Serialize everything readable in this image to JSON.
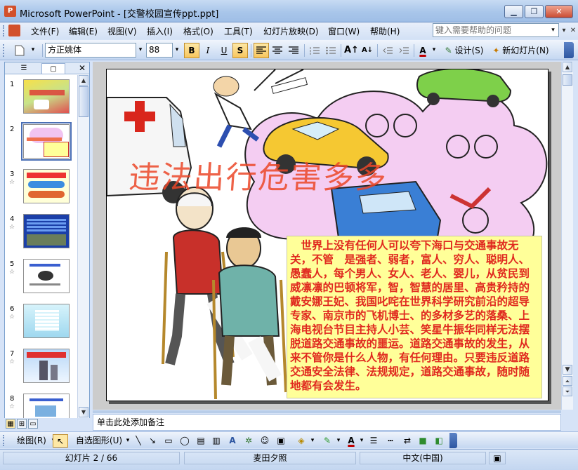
{
  "window": {
    "title": "Microsoft PowerPoint - [交警校园宣传ppt.ppt]",
    "app_icon_letter": "P",
    "controls": {
      "minimize": "▁",
      "restore": "❐",
      "close": "✕"
    }
  },
  "menu": {
    "items": [
      {
        "label": "文件(F)"
      },
      {
        "label": "编辑(E)"
      },
      {
        "label": "视图(V)"
      },
      {
        "label": "插入(I)"
      },
      {
        "label": "格式(O)"
      },
      {
        "label": "工具(T)"
      },
      {
        "label": "幻灯片放映(D)"
      },
      {
        "label": "窗口(W)"
      },
      {
        "label": "帮助(H)"
      }
    ],
    "help_placeholder": "键入需要帮助的问题",
    "help_drop": "▾",
    "mdi_controls": [
      "▾",
      "✕"
    ]
  },
  "toolbar": {
    "font_name": "方正姚体",
    "font_size": "88",
    "drop_glyph": "▾",
    "bold": "B",
    "italic": "I",
    "underline": "U",
    "shadow": "S",
    "increase_font": "A↑",
    "decrease_font": "A↓",
    "font_color": "A",
    "design_label": "设计(S)",
    "new_slide_label": "新幻灯片(N)",
    "align_left_active": true,
    "bold_active": true,
    "shadow_active": true
  },
  "side_pane": {
    "tab_outline": "☰",
    "tab_slides": "▢",
    "close": "✕",
    "selected_slide": 2,
    "slides": [
      {
        "num": "1",
        "star": ""
      },
      {
        "num": "2",
        "star": ""
      },
      {
        "num": "3",
        "star": "☆"
      },
      {
        "num": "4",
        "star": "☆"
      },
      {
        "num": "5",
        "star": "☆"
      },
      {
        "num": "6",
        "star": "☆"
      },
      {
        "num": "7",
        "star": "☆"
      },
      {
        "num": "8",
        "star": "☆"
      }
    ]
  },
  "slide": {
    "title": "违法出行危害多多",
    "body": "　世界上没有任何人可以夸下海口与交通事故无关，不管　是强者、弱者，富人、穷人、聪明人、愚蠢人，每个男人、女人、老人、婴儿，从贫民到威凛凛的巴顿将军，智，智慧的居里、高贵矜持的戴安娜王妃、我国叱咤在世界科学研究前沿的超导专家、南京市的飞机博士、的多材多艺的落桑、上海电视台节目主持人小芸、笑星牛振华同样无法摆脱道路交通事故的噩运。道路交通事故的发生，从来不管你是什么人物，有任何理由。只要违反道路交通安全法律、法规规定，道路交通事故，随时随地都有会发生。",
    "colors": {
      "title": "#eb4628",
      "body_text": "#e0291f",
      "textbox_bg": "#ffff99"
    }
  },
  "notes": {
    "placeholder": "单击此处添加备注"
  },
  "drawing": {
    "draw_label": "绘图(R)",
    "autoshape_label": "自选图形(U)"
  },
  "status": {
    "slide_info": "幻灯片 2 / 66",
    "template": "麦田夕照",
    "language": "中文(中国)"
  }
}
